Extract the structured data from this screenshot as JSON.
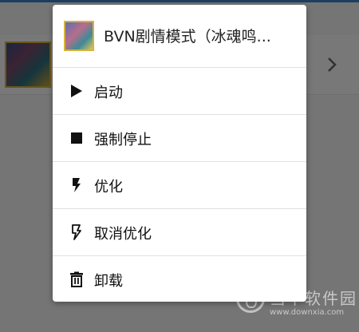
{
  "dialog": {
    "title": "BVN剧情模式（冰魂鸣...",
    "items": [
      {
        "label": "启动",
        "icon": "play-icon"
      },
      {
        "label": "强制停止",
        "icon": "stop-icon"
      },
      {
        "label": "优化",
        "icon": "flash-icon"
      },
      {
        "label": "取消优化",
        "icon": "flash-off-icon"
      },
      {
        "label": "卸载",
        "icon": "trash-icon"
      }
    ]
  },
  "watermark": {
    "title": "当下软件园",
    "url": "www.downxia.com"
  },
  "colors": {
    "accent": "#3b84c9",
    "icon": "#111111"
  }
}
